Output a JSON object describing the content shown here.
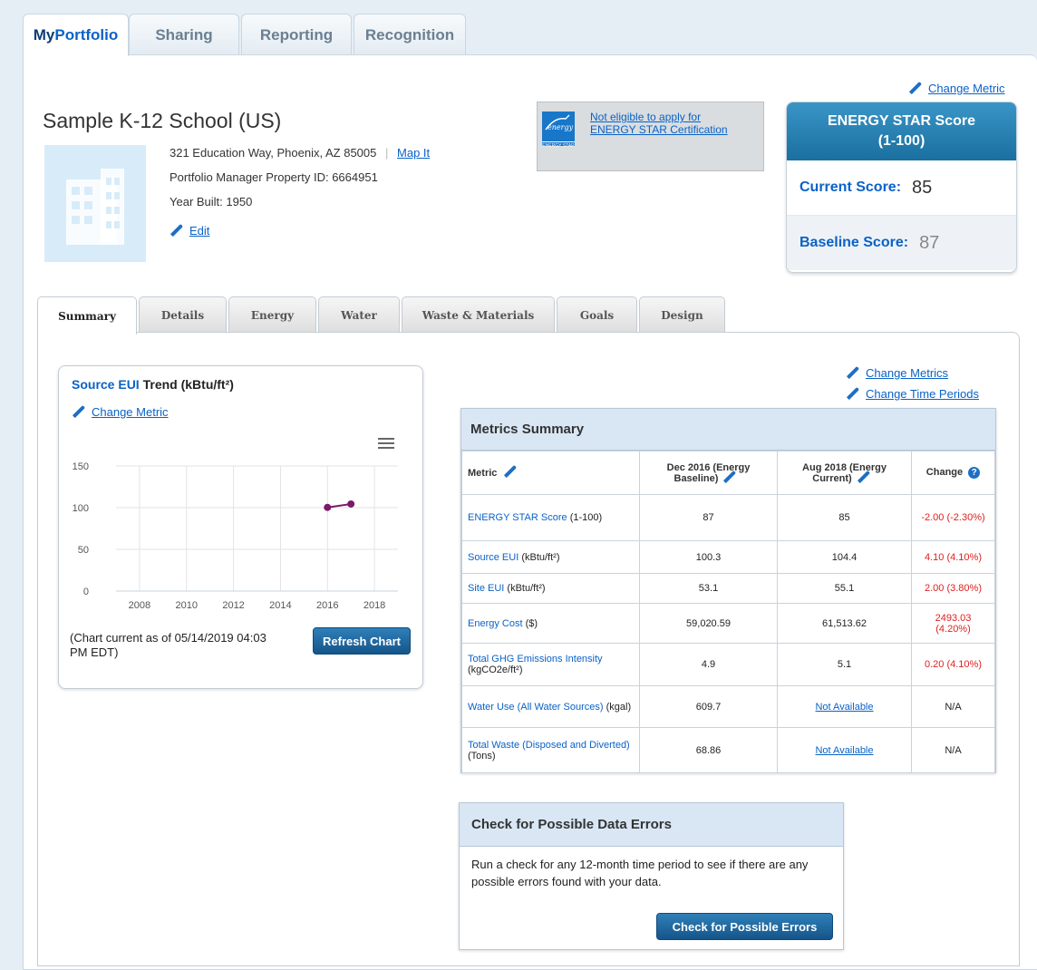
{
  "top_tabs": {
    "myportfolio_prefix": "My",
    "myportfolio_suffix": "Portfolio",
    "sharing": "Sharing",
    "reporting": "Reporting",
    "recognition": "Recognition"
  },
  "property": {
    "name": "Sample K-12 School (US)",
    "address": "321 Education Way, Phoenix, AZ 85005",
    "map_link": "Map It",
    "property_id": "Portfolio Manager Property ID: 6664951",
    "year_built": "Year Built: 1950",
    "edit_link": "Edit"
  },
  "header": {
    "change_metric": "Change Metric"
  },
  "certification": {
    "text": "Not eligible to apply for ENERGY STAR Certification",
    "logo_text": "ENERGY STAR"
  },
  "score_box": {
    "title_line1": "ENERGY STAR Score",
    "title_line2": "(1-100)",
    "current_label": "Current Score:",
    "current_value": "85",
    "baseline_label": "Baseline Score:",
    "baseline_value": "87"
  },
  "content_tabs": [
    "Summary",
    "Details",
    "Energy",
    "Water",
    "Waste & Materials",
    "Goals",
    "Design"
  ],
  "chart_card": {
    "title_link": "Source EUI",
    "title_rest": "Trend (kBtu/ft²)",
    "change_metric": "Change Metric",
    "note": "(Chart current as of 05/14/2019 04:03 PM EDT)",
    "refresh_button": "Refresh Chart"
  },
  "chart_data": {
    "type": "line",
    "x": [
      2016,
      2017
    ],
    "series": [
      {
        "values": [
          100.3,
          104.4
        ],
        "color": "#7b1a6b"
      }
    ],
    "xlim": [
      2007,
      2019
    ],
    "ylim": [
      0,
      150
    ],
    "x_ticks": [
      "2008",
      "2010",
      "2012",
      "2014",
      "2016",
      "2018"
    ],
    "y_ticks": [
      "0",
      "50",
      "100",
      "150"
    ],
    "grid": true
  },
  "links": {
    "change_metrics": "Change Metrics",
    "change_time_periods": "Change Time Periods"
  },
  "metrics": {
    "title": "Metrics Summary",
    "headers": {
      "metric": "Metric",
      "baseline": "Dec 2016 (Energy Baseline)",
      "current": "Aug 2018 (Energy Current)",
      "change": "Change"
    },
    "rows": [
      {
        "label": "ENERGY STAR Score",
        "unit": "(1-100)",
        "baseline": "87",
        "current": "85",
        "change": "-2.00 (-2.30%)"
      },
      {
        "label": "Source EUI",
        "unit": "(kBtu/ft²)",
        "baseline": "100.3",
        "current": "104.4",
        "change": "4.10 (4.10%)"
      },
      {
        "label": "Site EUI",
        "unit": "(kBtu/ft²)",
        "baseline": "53.1",
        "current": "55.1",
        "change": "2.00 (3.80%)"
      },
      {
        "label": "Energy Cost",
        "unit": "($)",
        "baseline": "59,020.59",
        "current": "61,513.62",
        "change": "2493.03 (4.20%)"
      },
      {
        "label": "Total GHG Emissions Intensity",
        "unit": "(kgCO2e/ft²)",
        "baseline": "4.9",
        "current": "5.1",
        "change": "0.20 (4.10%)"
      },
      {
        "label": "Water Use (All Water Sources)",
        "unit": "(kgal)",
        "baseline": "609.7",
        "current": "Not Available",
        "change": "N/A"
      },
      {
        "label": "Total Waste (Disposed and Diverted)",
        "unit": "(Tons)",
        "baseline": "68.86",
        "current": "Not Available",
        "change": "N/A"
      }
    ]
  },
  "errors_card": {
    "title": "Check for Possible Data Errors",
    "text": "Run a check for any 12-month time period to see if there are any possible errors found with your data.",
    "button": "Check for Possible Errors"
  }
}
